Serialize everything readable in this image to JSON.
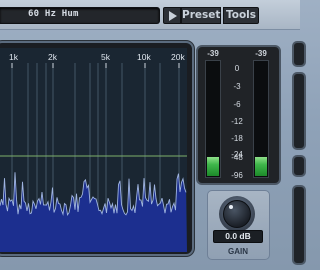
{
  "toolbar": {
    "preset_name": "60 Hz Hum",
    "preset_label": "Preset",
    "tools_label": "Tools"
  },
  "analyzer": {
    "freq_labels": [
      "1k",
      "2k",
      "5k",
      "10k",
      "20k"
    ]
  },
  "meters": {
    "left_peak": "-39",
    "right_peak": "-39",
    "left_level_db": -48,
    "right_level_db": -48,
    "scale": [
      "0",
      "-3",
      "-6",
      "-12",
      "-18",
      "-24",
      "-48",
      "-96"
    ]
  },
  "gain": {
    "value": "0.0 dB",
    "label": "GAIN"
  },
  "colors": {
    "spectrum_fill": "#1c2f8f",
    "spectrum_line": "#9fb4e0",
    "threshold_line": "#7db06a",
    "meter_green": "#3fb64a"
  }
}
